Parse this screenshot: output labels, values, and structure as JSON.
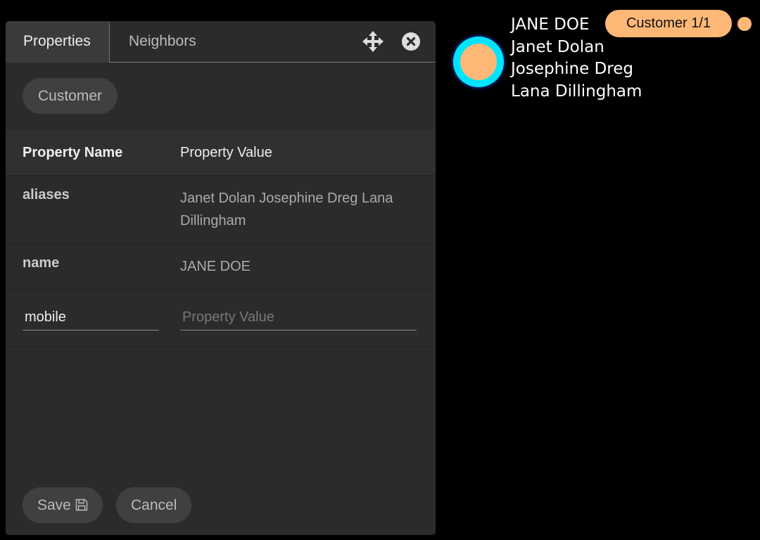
{
  "panel": {
    "tabs": [
      {
        "label": "Properties",
        "active": true
      },
      {
        "label": "Neighbors",
        "active": false
      }
    ],
    "icons": {
      "move": "move-arrows-icon",
      "close": "close-circle-icon"
    },
    "label_chip": "Customer",
    "table": {
      "headers": [
        "Property Name",
        "Property Value"
      ],
      "rows": [
        {
          "name": "aliases",
          "value": "Janet Dolan Josephine Dreg Lana Dillingham"
        },
        {
          "name": "name",
          "value": "JANE DOE"
        }
      ],
      "new_row": {
        "name_value": "mobile",
        "value_placeholder": "Property Value"
      }
    },
    "save_label": "Save",
    "cancel_label": "Cancel"
  },
  "graph": {
    "node_labels": [
      "JANE DOE",
      "Janet Dolan",
      "Josephine Dreg",
      "Lana Dillingham"
    ],
    "badge": "Customer 1/1",
    "colors": {
      "node_fill": "#fdb877",
      "node_ring": "#00e5ff"
    }
  }
}
